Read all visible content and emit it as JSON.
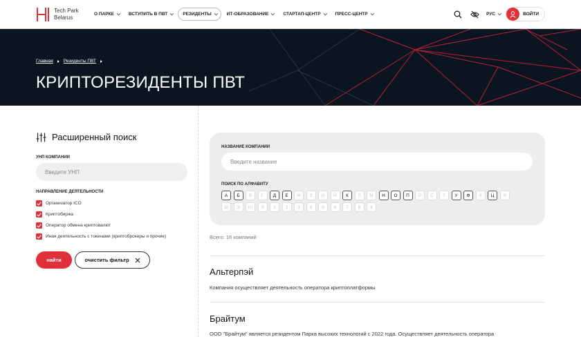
{
  "header": {
    "logo_line1": "Tech Park",
    "logo_line2": "Belarus",
    "nav": [
      {
        "label": "О ПАРКЕ",
        "active": false
      },
      {
        "label": "ВСТУПИТЬ В ПВТ",
        "active": false
      },
      {
        "label": "РЕЗИДЕНТЫ",
        "active": true
      },
      {
        "label": "ИТ-ОБРАЗОВАНИЕ",
        "active": false
      },
      {
        "label": "СТАРТАП-ЦЕНТР",
        "active": false
      },
      {
        "label": "ПРЕСС-ЦЕНТР",
        "active": false
      }
    ],
    "lang": "РУС",
    "login": "ВОЙТИ",
    "accent": "#e0303a"
  },
  "hero": {
    "breadcrumb": [
      "Главная",
      "Резиденты ПВТ"
    ],
    "title": "КРИПТОРЕЗИДЕНТЫ ПВТ"
  },
  "sidebar": {
    "title": "Расширенный поиск",
    "unp_label": "УНП КОМПАНИИ",
    "unp_placeholder": "Введите УНП",
    "direction_label": "НАПРАВЛЕНИЕ ДЕЯТЕЛЬНОСТИ",
    "options": [
      {
        "label": "Организатор ICO",
        "checked": true
      },
      {
        "label": "Криптобиржа",
        "checked": true
      },
      {
        "label": "Оператор обмена криптовалют",
        "checked": true
      },
      {
        "label": "Иная деятельность с токенами (криптоброкеры и прочие)",
        "checked": true
      }
    ],
    "find_label": "найти",
    "clear_label": "очистить фильтр"
  },
  "search": {
    "name_label": "НАЗВАНИЕ КОМПАНИИ",
    "name_placeholder": "Введите название",
    "alpha_label": "ПОИСК ПО АЛФАВИТУ",
    "row1": [
      {
        "ch": "А",
        "on": true
      },
      {
        "ch": "Б",
        "on": true
      },
      {
        "ch": "В",
        "on": false
      },
      {
        "ch": "Г",
        "on": false
      },
      {
        "ch": "Д",
        "on": true
      },
      {
        "ch": "Е",
        "on": true
      },
      {
        "ch": "Ж",
        "on": false
      },
      {
        "ch": "З",
        "on": false
      },
      {
        "ch": "И",
        "on": false
      },
      {
        "ch": "Й",
        "on": false
      },
      {
        "ch": "К",
        "on": true
      },
      {
        "ch": "Л",
        "on": false
      },
      {
        "ch": "М",
        "on": false
      },
      {
        "ch": "Н",
        "on": true
      },
      {
        "ch": "О",
        "on": true
      },
      {
        "ch": "П",
        "on": true
      },
      {
        "ch": "Р",
        "on": false
      },
      {
        "ch": "С",
        "on": false
      },
      {
        "ch": "Т",
        "on": false
      },
      {
        "ch": "У",
        "on": true
      },
      {
        "ch": "Ф",
        "on": true
      },
      {
        "ch": "Х",
        "on": false
      },
      {
        "ch": "Ц",
        "on": true
      },
      {
        "ch": "Ч",
        "on": false
      }
    ],
    "row2": [
      {
        "ch": "Ш",
        "on": false
      },
      {
        "ch": "Э",
        "on": false
      },
      {
        "ch": "Ю",
        "on": false
      },
      {
        "ch": "Я",
        "on": false
      },
      {
        "ch": "1",
        "on": false
      },
      {
        "ch": "2",
        "on": false
      },
      {
        "ch": "3",
        "on": false
      },
      {
        "ch": "4",
        "on": false
      },
      {
        "ch": "5",
        "on": false
      },
      {
        "ch": "6",
        "on": false
      },
      {
        "ch": "7",
        "on": false
      },
      {
        "ch": "8",
        "on": false
      },
      {
        "ch": "9",
        "on": false
      }
    ]
  },
  "results": {
    "total": "Всего: 16 компаний",
    "items": [
      {
        "name": "Альтерпэй",
        "desc": "Компания осуществляет деятельность оператора криптоплатформы"
      },
      {
        "name": "Брайтум",
        "desc": "ООО \"Брайтум\" является резидентом Парка высоких технологий с 2022 года. Осуществляет деятельность оператора"
      }
    ]
  }
}
